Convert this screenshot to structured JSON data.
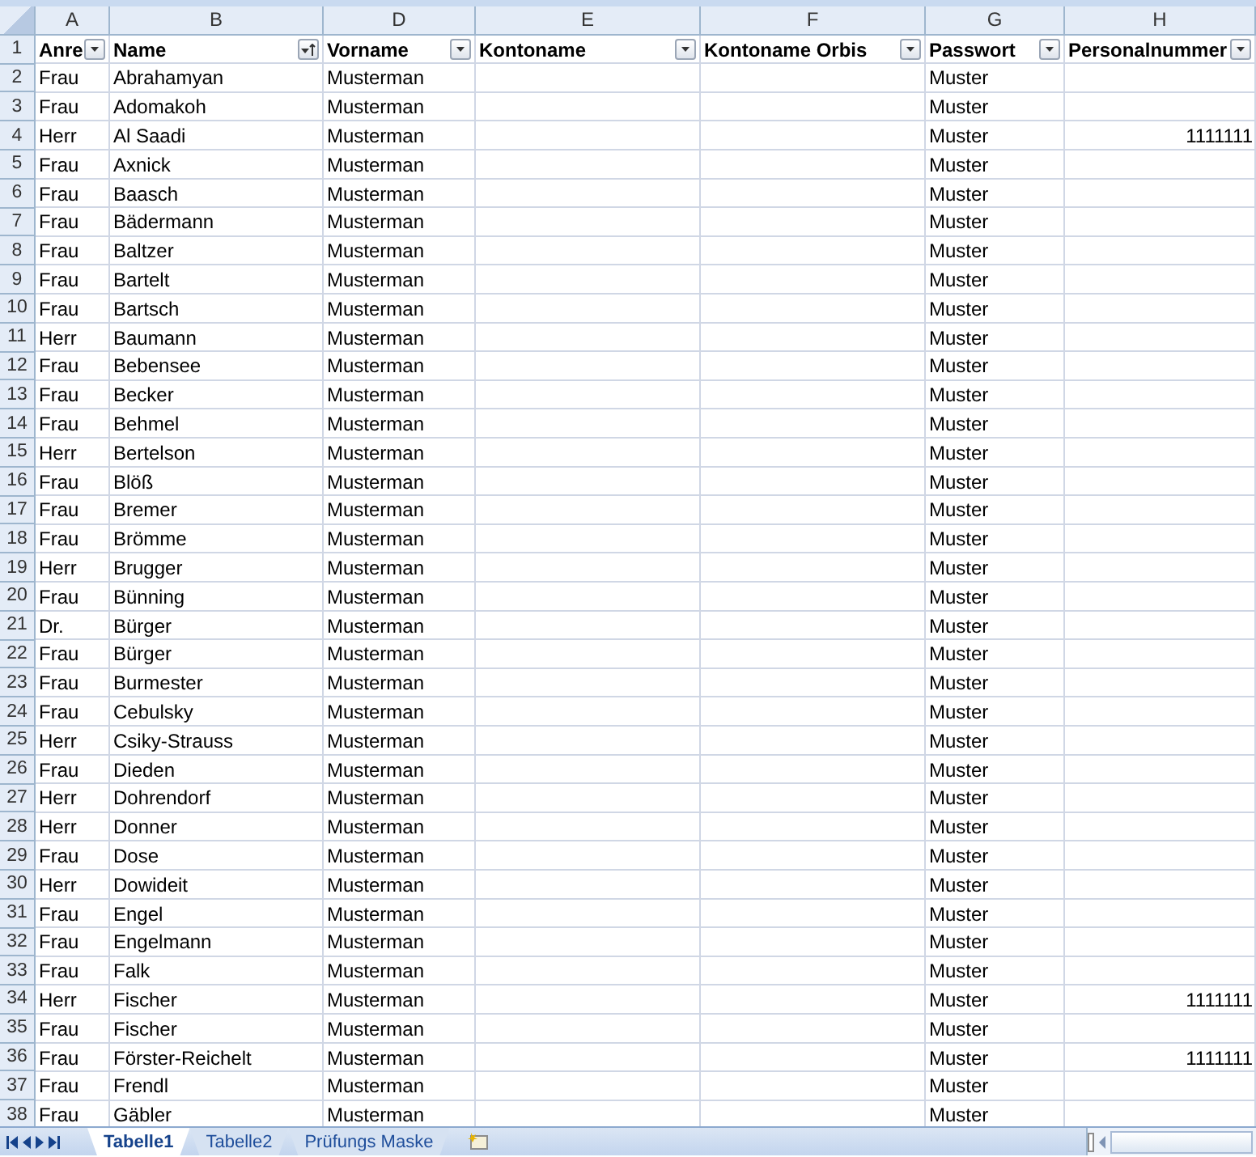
{
  "header_row_number": "1",
  "columns": [
    {
      "letter": "A",
      "header": "Anre",
      "sorted": false
    },
    {
      "letter": "B",
      "header": "Name",
      "sorted": true
    },
    {
      "letter": "D",
      "header": "Vorname",
      "sorted": false
    },
    {
      "letter": "E",
      "header": "Kontoname",
      "sorted": false
    },
    {
      "letter": "F",
      "header": "Kontoname Orbis",
      "sorted": false
    },
    {
      "letter": "G",
      "header": "Passwort",
      "sorted": false
    },
    {
      "letter": "H",
      "header": "Personalnummer",
      "sorted": false
    }
  ],
  "rows": [
    {
      "row": "2",
      "anrede": "Frau",
      "name": "Abrahamyan",
      "vorname": "Musterman",
      "passwort": "Muster"
    },
    {
      "row": "3",
      "anrede": "Frau",
      "name": "Adomakoh",
      "vorname": "Musterman",
      "passwort": "Muster"
    },
    {
      "row": "4",
      "anrede": "Herr",
      "name": "Al Saadi",
      "vorname": "Musterman",
      "passwort": "Muster",
      "personalnummer": "1111111"
    },
    {
      "row": "5",
      "anrede": "Frau",
      "name": "Axnick",
      "vorname": "Musterman",
      "passwort": "Muster"
    },
    {
      "row": "6",
      "anrede": "Frau",
      "name": "Baasch",
      "vorname": "Musterman",
      "passwort": "Muster"
    },
    {
      "row": "7",
      "anrede": "Frau",
      "name": "Bädermann",
      "vorname": "Musterman",
      "passwort": "Muster"
    },
    {
      "row": "8",
      "anrede": "Frau",
      "name": "Baltzer",
      "vorname": "Musterman",
      "passwort": "Muster"
    },
    {
      "row": "9",
      "anrede": "Frau",
      "name": "Bartelt",
      "vorname": "Musterman",
      "passwort": "Muster"
    },
    {
      "row": "10",
      "anrede": "Frau",
      "name": "Bartsch",
      "vorname": "Musterman",
      "passwort": "Muster"
    },
    {
      "row": "11",
      "anrede": "Herr",
      "name": "Baumann",
      "vorname": "Musterman",
      "passwort": "Muster"
    },
    {
      "row": "12",
      "anrede": "Frau",
      "name": "Bebensee",
      "vorname": "Musterman",
      "passwort": "Muster"
    },
    {
      "row": "13",
      "anrede": "Frau",
      "name": "Becker",
      "vorname": "Musterman",
      "passwort": "Muster"
    },
    {
      "row": "14",
      "anrede": "Frau",
      "name": "Behmel",
      "vorname": "Musterman",
      "passwort": "Muster"
    },
    {
      "row": "15",
      "anrede": "Herr",
      "name": "Bertelson",
      "vorname": "Musterman",
      "passwort": "Muster"
    },
    {
      "row": "16",
      "anrede": "Frau",
      "name": "Blöß",
      "vorname": "Musterman",
      "passwort": "Muster"
    },
    {
      "row": "17",
      "anrede": "Frau",
      "name": "Bremer",
      "vorname": "Musterman",
      "passwort": "Muster"
    },
    {
      "row": "18",
      "anrede": "Frau",
      "name": "Brömme",
      "vorname": "Musterman",
      "passwort": "Muster"
    },
    {
      "row": "19",
      "anrede": "Herr",
      "name": "Brugger",
      "vorname": "Musterman",
      "passwort": "Muster"
    },
    {
      "row": "20",
      "anrede": "Frau",
      "name": "Bünning",
      "vorname": "Musterman",
      "passwort": "Muster"
    },
    {
      "row": "21",
      "anrede": "Dr.",
      "name": "Bürger",
      "vorname": "Musterman",
      "passwort": "Muster"
    },
    {
      "row": "22",
      "anrede": "Frau",
      "name": "Bürger",
      "vorname": "Musterman",
      "passwort": "Muster"
    },
    {
      "row": "23",
      "anrede": "Frau",
      "name": "Burmester",
      "vorname": "Musterman",
      "passwort": "Muster"
    },
    {
      "row": "24",
      "anrede": "Frau",
      "name": "Cebulsky",
      "vorname": "Musterman",
      "passwort": "Muster"
    },
    {
      "row": "25",
      "anrede": "Herr",
      "name": "Csiky-Strauss",
      "vorname": "Musterman",
      "passwort": "Muster"
    },
    {
      "row": "26",
      "anrede": "Frau",
      "name": "Dieden",
      "vorname": "Musterman",
      "passwort": "Muster"
    },
    {
      "row": "27",
      "anrede": "Herr",
      "name": "Dohrendorf",
      "vorname": "Musterman",
      "passwort": "Muster"
    },
    {
      "row": "28",
      "anrede": "Herr",
      "name": "Donner",
      "vorname": "Musterman",
      "passwort": "Muster"
    },
    {
      "row": "29",
      "anrede": "Frau",
      "name": "Dose",
      "vorname": "Musterman",
      "passwort": "Muster"
    },
    {
      "row": "30",
      "anrede": "Herr",
      "name": "Dowideit",
      "vorname": "Musterman",
      "passwort": "Muster"
    },
    {
      "row": "31",
      "anrede": "Frau",
      "name": "Engel",
      "vorname": "Musterman",
      "passwort": "Muster"
    },
    {
      "row": "32",
      "anrede": "Frau",
      "name": "Engelmann",
      "vorname": "Musterman",
      "passwort": "Muster"
    },
    {
      "row": "33",
      "anrede": "Frau",
      "name": "Falk",
      "vorname": "Musterman",
      "passwort": "Muster"
    },
    {
      "row": "34",
      "anrede": "Herr",
      "name": "Fischer",
      "vorname": "Musterman",
      "passwort": "Muster",
      "personalnummer": "1111111"
    },
    {
      "row": "35",
      "anrede": "Frau",
      "name": "Fischer",
      "vorname": "Musterman",
      "passwort": "Muster"
    },
    {
      "row": "36",
      "anrede": "Frau",
      "name": "Förster-Reichelt",
      "vorname": "Musterman",
      "passwort": "Muster",
      "personalnummer": "1111111"
    },
    {
      "row": "37",
      "anrede": "Frau",
      "name": "Frendl",
      "vorname": "Musterman",
      "passwort": "Muster"
    },
    {
      "row": "38",
      "anrede": "Frau",
      "name": "Gäbler",
      "vorname": "Musterman",
      "passwort": "Muster"
    }
  ],
  "sheet_tabs": [
    {
      "label": "Tabelle1",
      "selected": true
    },
    {
      "label": "Tabelle2",
      "selected": false
    },
    {
      "label": "Prüfungs Maske",
      "selected": false
    }
  ]
}
